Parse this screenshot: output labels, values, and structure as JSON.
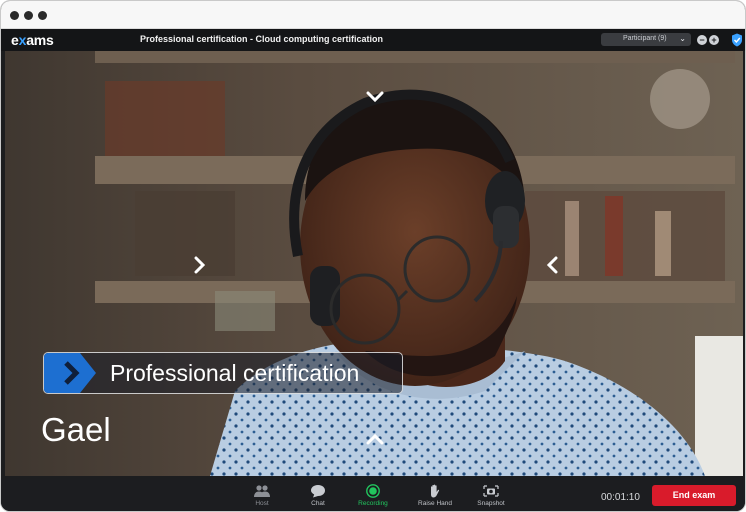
{
  "app": {
    "logo": {
      "pre": "e",
      "mark": "x",
      "post": "ams"
    },
    "title": "Professional certification - Cloud computing certification"
  },
  "header": {
    "participant_select": "Participant (9)",
    "zoom_out": "−",
    "zoom_in": "+",
    "shield_icon": "shield-check-icon"
  },
  "video": {
    "caption": "Professional certification",
    "participant_name": "Gael",
    "nav_arrows": [
      "chevron-down-icon",
      "chevron-right-icon",
      "chevron-left-icon",
      "chevron-up-icon"
    ]
  },
  "toolbar": {
    "items": [
      {
        "label": "Host",
        "icon": "host-icon"
      },
      {
        "label": "Chat",
        "icon": "chat-icon"
      },
      {
        "label": "Recording",
        "icon": "record-icon"
      },
      {
        "label": "Raise Hand",
        "icon": "hand-icon"
      },
      {
        "label": "Snapshot",
        "icon": "camera-icon"
      }
    ],
    "timer": "00:01:10",
    "end_label": "End exam"
  },
  "colors": {
    "accent": "#3aa1ff",
    "recording": "#22c55e",
    "end_button": "#d91b2b"
  }
}
